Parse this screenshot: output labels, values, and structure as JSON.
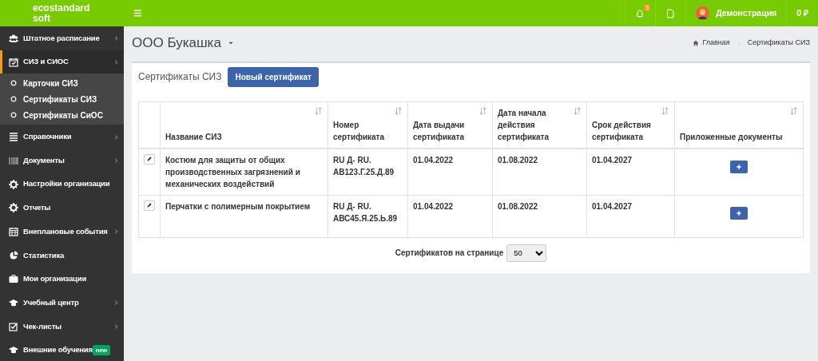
{
  "header": {
    "logo": "ecostandard soft",
    "notifications_count": "5",
    "user_name": "Демонстрация",
    "balance": "0 ₽"
  },
  "sidebar": {
    "items": [
      {
        "label": "Штатное расписание",
        "has_submenu": true,
        "selected": false
      },
      {
        "label": "СИЗ и СИОС",
        "has_submenu": true,
        "selected": true,
        "expanded": true,
        "children": [
          {
            "label": "Карточки СИЗ",
            "selected": false
          },
          {
            "label": "Сертификаты СИЗ",
            "selected": false
          },
          {
            "label": "Сертификаты СиОС",
            "selected": false
          }
        ]
      },
      {
        "label": "Справочники",
        "has_submenu": true,
        "selected": false
      },
      {
        "label": "Документы",
        "has_submenu": true,
        "selected": false
      },
      {
        "label": "Настройки организации",
        "has_submenu": false,
        "selected": false
      },
      {
        "label": "Отчеты",
        "has_submenu": false,
        "selected": false
      },
      {
        "label": "Внеплановые события",
        "has_submenu": true,
        "selected": false
      },
      {
        "label": "Статистика",
        "has_submenu": false,
        "selected": false
      },
      {
        "label": "Мои организации",
        "has_submenu": false,
        "selected": false
      },
      {
        "label": "Учебный центр",
        "has_submenu": true,
        "selected": false
      },
      {
        "label": "Чек-листы",
        "has_submenu": true,
        "selected": false
      },
      {
        "label": "Внешние обучения",
        "has_submenu": false,
        "selected": false,
        "badge": "new"
      }
    ]
  },
  "organization": "ООО Букашка",
  "breadcrumbs": [
    "Главная",
    "Сертификаты СИЗ"
  ],
  "panel": {
    "title": "Сертификаты СИЗ",
    "new_button": "Новый сертификат"
  },
  "table": {
    "columns": [
      "Название СИЗ",
      "Номер сертификата",
      "Дата выдачи сертификата",
      "Дата начала действия сертификата",
      "Срок действия сертификата",
      "Приложенные документы"
    ],
    "rows": [
      {
        "name": "Костюм для защиты от общих производственных загрязнений и механических воздействий",
        "number": "RU Д- RU. АВ123.Г.25.Д.89",
        "issued": "01.04.2022",
        "start": "01.08.2022",
        "expiry": "01.04.2027"
      },
      {
        "name": "Перчатки с полимерным покрытием",
        "number": "RU Д- RU. АВС45.Я.25.Ь.89",
        "issued": "01.04.2022",
        "start": "01.08.2022",
        "expiry": "01.04.2027"
      }
    ]
  },
  "pagination": {
    "label": "Сертификатов на странице",
    "per_page": "50"
  }
}
